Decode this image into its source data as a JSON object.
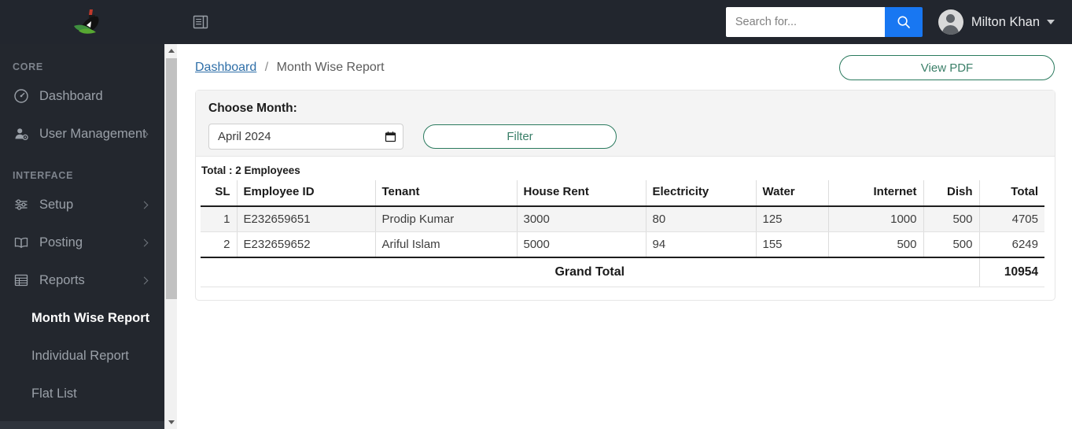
{
  "header": {
    "logo_name": "app-logo",
    "toggle_icon": "sidebar-toggle-icon",
    "search": {
      "placeholder": "Search for...",
      "value": "",
      "button_icon": "search-icon"
    },
    "user": {
      "name": "Milton Khan",
      "avatar_icon": "user-avatar-icon",
      "caret_icon": "chevron-down-icon"
    }
  },
  "sidebar": {
    "sections": [
      {
        "label": "CORE",
        "items": [
          {
            "label": "Dashboard",
            "icon": "gauge-icon",
            "has_chevron": false,
            "active": false
          },
          {
            "label": "User Management",
            "icon": "user-cog-icon",
            "has_chevron": true,
            "active": false
          }
        ]
      },
      {
        "label": "INTERFACE",
        "items": [
          {
            "label": "Setup",
            "icon": "sliders-icon",
            "has_chevron": true,
            "active": false
          },
          {
            "label": "Posting",
            "icon": "book-open-icon",
            "has_chevron": true,
            "active": false
          },
          {
            "label": "Reports",
            "icon": "table-report-icon",
            "has_chevron": true,
            "active": false
          }
        ]
      }
    ],
    "sub_items": [
      {
        "label": "Month Wise Report",
        "active": true
      },
      {
        "label": "Individual Report",
        "active": false
      },
      {
        "label": "Flat List",
        "active": false
      }
    ],
    "scrollbar": {
      "up_arrow_icon": "scroll-up-arrow-icon",
      "down_arrow_icon": "scroll-down-arrow-icon"
    }
  },
  "main": {
    "breadcrumb": {
      "link": "Dashboard",
      "separator": "/",
      "current": "Month Wise Report"
    },
    "view_pdf_label": "View PDF",
    "filter": {
      "label": "Choose Month:",
      "month_value": "April 2024",
      "calendar_icon": "calendar-icon",
      "filter_button_label": "Filter"
    },
    "total_line": "Total : 2 Employees",
    "table": {
      "columns": [
        {
          "label": "SL",
          "align": "right"
        },
        {
          "label": "Employee ID",
          "align": "left"
        },
        {
          "label": "Tenant",
          "align": "left"
        },
        {
          "label": "House Rent",
          "align": "left"
        },
        {
          "label": "Electricity",
          "align": "left"
        },
        {
          "label": "Water",
          "align": "left"
        },
        {
          "label": "Internet",
          "align": "right"
        },
        {
          "label": "Dish",
          "align": "right"
        },
        {
          "label": "Total",
          "align": "right"
        }
      ],
      "rows": [
        {
          "sl": "1",
          "employee_id": "E232659651",
          "tenant": "Prodip Kumar",
          "house_rent": "3000",
          "electricity": "80",
          "water": "125",
          "internet": "1000",
          "dish": "500",
          "total": "4705"
        },
        {
          "sl": "2",
          "employee_id": "E232659652",
          "tenant": "Ariful Islam",
          "house_rent": "5000",
          "electricity": "94",
          "water": "155",
          "internet": "500",
          "dish": "500",
          "total": "6249"
        }
      ],
      "grand_total_label": "Grand Total",
      "grand_total_value": "10954"
    }
  },
  "colors": {
    "sidebar_bg": "#23272e",
    "topbar_bg": "#22262e",
    "search_button": "#1877f2",
    "accent_green": "#2a7a5e",
    "link_blue": "#2f6fa8",
    "zebra_row": "#f4f4f4"
  }
}
